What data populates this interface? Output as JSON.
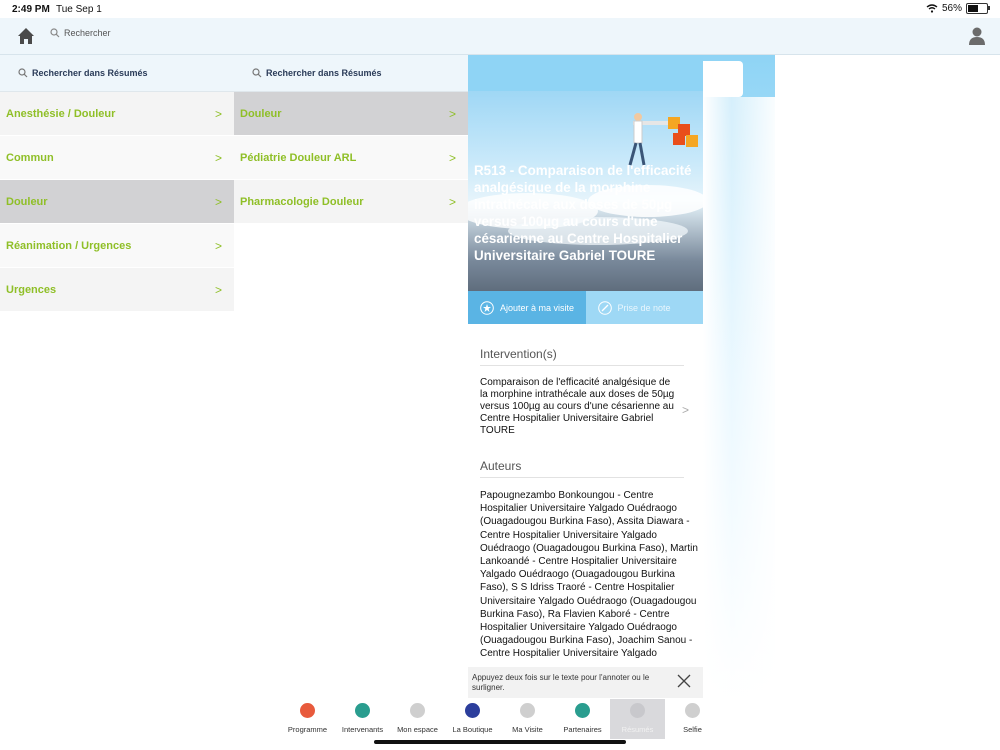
{
  "status_bar": {
    "time": "2:49 PM",
    "date": "Tue Sep 1",
    "battery": "56%",
    "battery_level": 0.56
  },
  "topbar": {
    "search_label": "Rechercher"
  },
  "column1": {
    "search_label": "Rechercher dans Résumés",
    "items": [
      {
        "label": "Anesthésie / Douleur"
      },
      {
        "label": "Commun"
      },
      {
        "label": "Douleur"
      },
      {
        "label": "Réanimation / Urgences"
      },
      {
        "label": "Urgences"
      }
    ]
  },
  "column2": {
    "search_label": "Rechercher dans Résumés",
    "items": [
      {
        "label": "Douleur"
      },
      {
        "label": "Pédiatrie Douleur ARL"
      },
      {
        "label": "Pharmacologie Douleur"
      }
    ]
  },
  "detail": {
    "title": "R513 - Comparaison de l'efficacité analgésique de la morphine intrathécale aux doses de 50µg versus 100µg au cours d'une césarienne au Centre Hospitalier Universitaire Gabriel TOURE",
    "actions": {
      "add_visit": "Ajouter à ma visite",
      "take_note": "Prise de note"
    },
    "intervention_header": "Intervention(s)",
    "intervention_text": "Comparaison de l'efficacité analgésique de la morphine intrathécale aux doses de 50µg versus 100µg au cours d'une césarienne au Centre Hospitalier Universitaire Gabriel TOURE",
    "authors_header": "Auteurs",
    "authors_text": "Papougnezambo Bonkoungou - Centre Hospitalier Universitaire Yalgado Ouédraogo (Ouagadougou Burkina Faso), Assita Diawara - Centre Hospitalier Universitaire Yalgado Ouédraogo (Ouagadougou Burkina Faso), Martin Lankoandé - Centre Hospitalier Universitaire Yalgado Ouédraogo (Ouagadougou Burkina Faso), S S Idriss Traoré - Centre Hospitalier Universitaire Yalgado Ouédraogo (Ouagadougou Burkina Faso), Ra Flavien Kaboré - Centre Hospitalier Universitaire Yalgado Ouédraogo (Ouagadougou Burkina Faso), Joachim Sanou - Centre Hospitalier Universitaire Yalgado",
    "hint": "Appuyez deux fois sur le texte pour l'annoter ou le surligner."
  },
  "tabbar": {
    "tabs": [
      {
        "label": "Programme",
        "color": "#e85a3c"
      },
      {
        "label": "Intervenants",
        "color": "#2a9d8f"
      },
      {
        "label": "Mon espace",
        "color": "#cfcfcf"
      },
      {
        "label": "La Boutique",
        "color": "#2c3e9c"
      },
      {
        "label": "Ma Visite",
        "color": "#cfcfcf"
      },
      {
        "label": "Partenaires",
        "color": "#2a9d8f"
      },
      {
        "label": "Résumés",
        "color": "#c8c8cc"
      },
      {
        "label": "Selfie",
        "color": "#cfcfcf"
      }
    ],
    "selected": "Résumés"
  },
  "icons": [
    "home-icon",
    "search-icon",
    "user-icon",
    "chevron-right-icon",
    "star-icon",
    "note-icon",
    "close-icon",
    "wifi-icon",
    "battery-icon"
  ]
}
